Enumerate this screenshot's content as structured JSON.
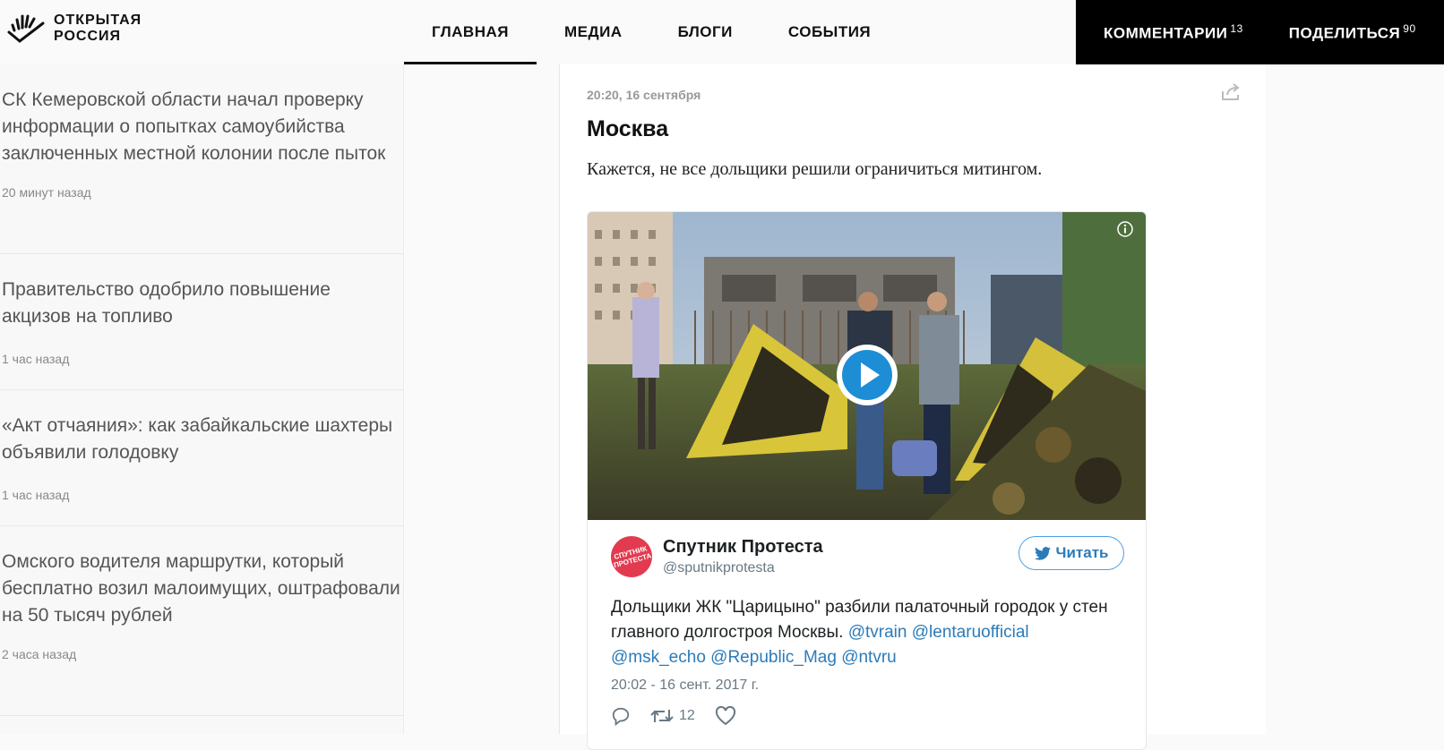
{
  "header": {
    "logo_line1": "ОТКРЫТАЯ",
    "logo_line2": "РОССИЯ",
    "nav": [
      "ГЛАВНАЯ",
      "МЕДИА",
      "БЛОГИ",
      "СОБЫТИЯ"
    ],
    "comments_label": "КОММЕНТАРИИ",
    "comments_count": "13",
    "share_label": "ПОДЕЛИТЬСЯ",
    "share_count": "90"
  },
  "news": [
    {
      "title": "СК Кемеровской области начал проверку информации о попытках самоубийства заключенных местной колонии после пыток",
      "time": "20 минут назад"
    },
    {
      "title": "Правительство одобрило повышение акцизов на топливо",
      "time": "1 час назад"
    },
    {
      "title": "«Акт отчаяния»: как забайкальские шахтеры объявили голодовку",
      "time": "1 час назад"
    },
    {
      "title": "Омского водителя маршрутки, который бесплатно возил малоимущих, оштрафовали на 50 тысяч рублей",
      "time": "2 часа назад"
    }
  ],
  "post": {
    "time": "20:20, 16 сентября",
    "title": "Москва",
    "text": "Кажется, не все дольщики решили ограничиться митингом."
  },
  "tweet": {
    "author_name": "Спутник Протеста",
    "author_handle": "@sputnikprotesta",
    "avatar_text": "СПУТНИК ПРОТЕСТА",
    "follow_label": "Читать",
    "text": "Дольщики ЖК \"Царицыно\" разбили палаточный городок у стен главного долгостроя Москвы.",
    "mentions": [
      "@tvrain",
      "@lentaruofficial",
      "@msk_echo",
      "@Republic_Mag",
      "@ntvru"
    ],
    "date": "20:02 - 16 сент. 2017 г.",
    "retweets": "12",
    "icons": [
      "reply-icon",
      "retweet-icon",
      "like-icon",
      "play-icon",
      "info-icon",
      "twitter-bird-icon"
    ]
  },
  "colors": {
    "accent": "#2b7bb9",
    "header_dark": "#000000",
    "avatar": "#e23b50"
  }
}
